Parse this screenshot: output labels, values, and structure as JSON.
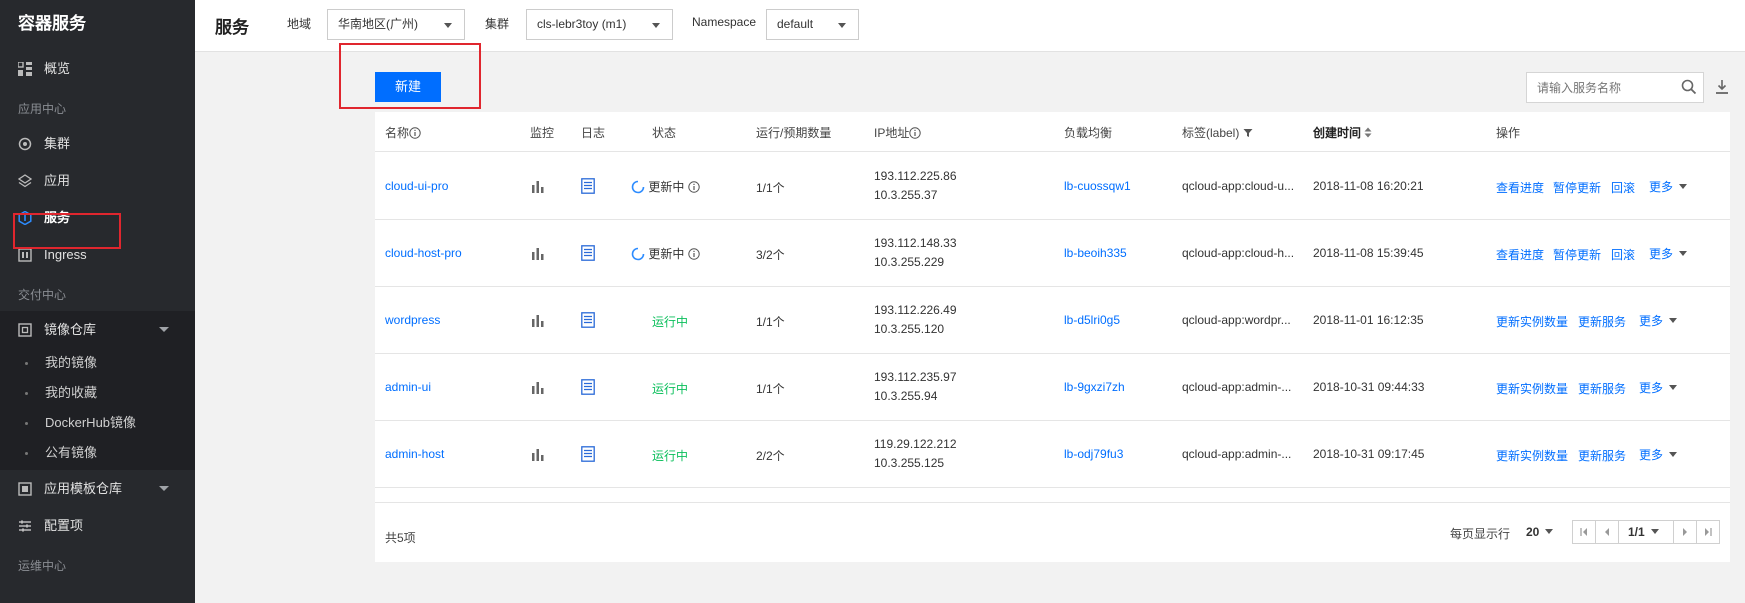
{
  "sidebar": {
    "title": "容器服务",
    "items": {
      "overview": "概览",
      "group_app": "应用中心",
      "cluster": "集群",
      "app": "应用",
      "service": "服务",
      "ingress": "Ingress",
      "group_delivery": "交付中心",
      "registry": "镜像仓库",
      "my_images": "我的镜像",
      "my_favorites": "我的收藏",
      "dockerhub": "DockerHub镜像",
      "public_images": "公有镜像",
      "templates": "应用模板仓库",
      "config": "配置项",
      "group_ops": "运维中心"
    }
  },
  "topbar": {
    "title": "服务",
    "region_label": "地域",
    "region_value": "华南地区(广州)",
    "cluster_label": "集群",
    "cluster_value": "cls-lebr3toy (m1)",
    "namespace_label": "Namespace",
    "namespace_value": "default"
  },
  "toolbar": {
    "new_label": "新建",
    "search_placeholder": "请输入服务名称"
  },
  "table": {
    "headers": {
      "name": "名称",
      "monitor": "监控",
      "log": "日志",
      "status": "状态",
      "count": "运行/预期数量",
      "ip": "IP地址",
      "lb": "负载均衡",
      "label": "标签(label)",
      "created": "创建时间",
      "ops": "操作"
    },
    "rows": [
      {
        "name": "cloud-ui-pro",
        "status": "更新中",
        "count": "1/1个",
        "ip1": "193.112.225.86",
        "ip2": "10.3.255.37",
        "lb": "lb-cuossqw1",
        "label": "qcloud-app:cloud-u...",
        "created": "2018-11-08 16:20:21",
        "op1": "查看进度",
        "op2": "暂停更新",
        "op3": "回滚",
        "more": "更多"
      },
      {
        "name": "cloud-host-pro",
        "status": "更新中",
        "count": "3/2个",
        "ip1": "193.112.148.33",
        "ip2": "10.3.255.229",
        "lb": "lb-beoih335",
        "label": "qcloud-app:cloud-h...",
        "created": "2018-11-08 15:39:45",
        "op1": "查看进度",
        "op2": "暂停更新",
        "op3": "回滚",
        "more": "更多"
      },
      {
        "name": "wordpress",
        "status": "运行中",
        "count": "1/1个",
        "ip1": "193.112.226.49",
        "ip2": "10.3.255.120",
        "lb": "lb-d5lri0g5",
        "label": "qcloud-app:wordpr...",
        "created": "2018-11-01 16:12:35",
        "op1": "更新实例数量",
        "op2": "更新服务",
        "more": "更多"
      },
      {
        "name": "admin-ui",
        "status": "运行中",
        "count": "1/1个",
        "ip1": "193.112.235.97",
        "ip2": "10.3.255.94",
        "lb": "lb-9gxzi7zh",
        "label": "qcloud-app:admin-...",
        "created": "2018-10-31 09:44:33",
        "op1": "更新实例数量",
        "op2": "更新服务",
        "more": "更多"
      },
      {
        "name": "admin-host",
        "status": "运行中",
        "count": "2/2个",
        "ip1": "119.29.122.212",
        "ip2": "10.3.255.125",
        "lb": "lb-odj79fu3",
        "label": "qcloud-app:admin-...",
        "created": "2018-10-31 09:17:45",
        "op1": "更新实例数量",
        "op2": "更新服务",
        "more": "更多"
      }
    ]
  },
  "footer": {
    "total": "共5项",
    "per_page_label": "每页显示行",
    "per_page_value": "20",
    "page_value": "1/1"
  },
  "colors": {
    "primary": "#006eff",
    "running": "#0abf5b",
    "sidebar_bg": "#27292d",
    "highlight": "#e0262e"
  }
}
